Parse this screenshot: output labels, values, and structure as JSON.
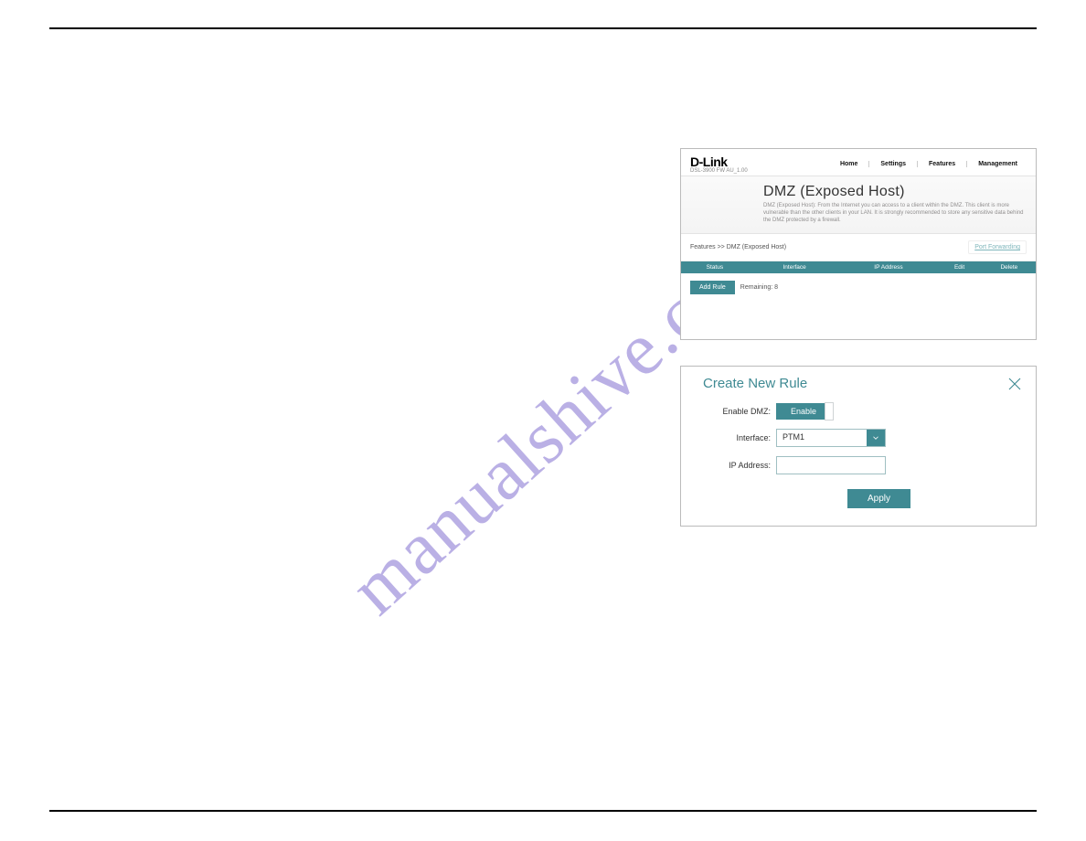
{
  "watermark": "manualshive.com",
  "screenshot1": {
    "brand": "D-Link",
    "model_line": "DSL-3900  FW AU_1.00",
    "nav": {
      "home": "Home",
      "settings": "Settings",
      "features": "Features",
      "management": "Management"
    },
    "title": "DMZ (Exposed Host)",
    "description": "DMZ (Exposed Host): From the Internet you can access to a client within the DMZ. This client is more vulnerable than the other clients in your LAN. It is strongly recommended to store any sensitive data behind the DMZ protected by a firewall.",
    "breadcrumb": "Features >> DMZ (Exposed Host)",
    "port_forwarding_link": "Port Forwarding",
    "thead": {
      "status": "Status",
      "interface": "Interface",
      "ip": "IP Address",
      "edit": "Edit",
      "delete": "Delete"
    },
    "add_rule_label": "Add Rule",
    "remaining_label": "Remaining: 8"
  },
  "screenshot2": {
    "title": "Create New Rule",
    "labels": {
      "enable": "Enable DMZ:",
      "interface": "Interface:",
      "ip": "IP Address:"
    },
    "toggle_text": "Enable",
    "interface_value": "PTM1",
    "ip_value": "",
    "apply_label": "Apply"
  }
}
